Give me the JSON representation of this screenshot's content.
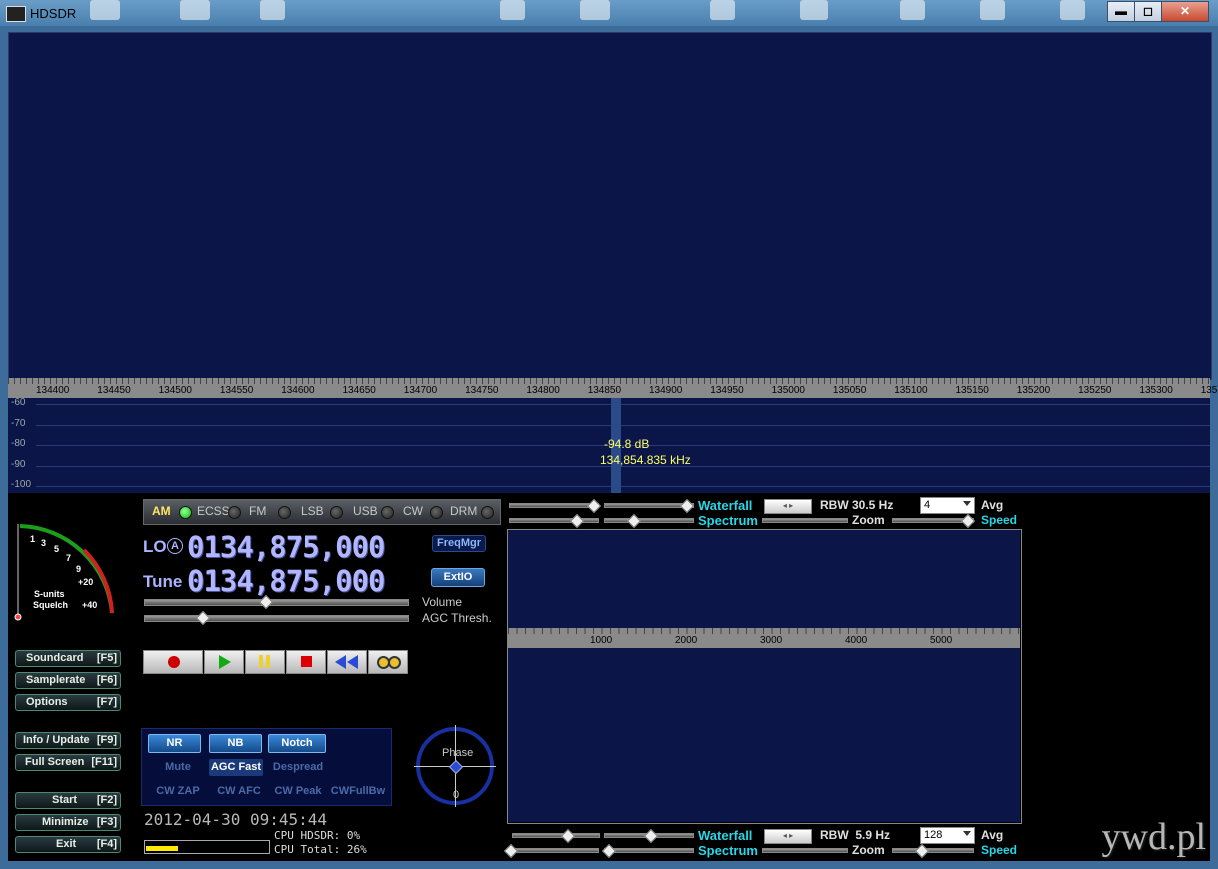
{
  "window": {
    "title": "HDSDR",
    "btn_minimize": "▬",
    "btn_maximize": "◻",
    "btn_close": "✕"
  },
  "freq_axis": [
    "134400",
    "134450",
    "134500",
    "134550",
    "134600",
    "134650",
    "134700",
    "134750",
    "134800",
    "134850",
    "134900",
    "134950",
    "135000",
    "135050",
    "135100",
    "135150",
    "135200",
    "135250",
    "135300",
    "135"
  ],
  "db_scale": [
    "-60",
    "-70",
    "-80",
    "-90",
    "-100"
  ],
  "cursor": {
    "level": "-94.8 dB",
    "freq": "134,854.835 kHz"
  },
  "smeter": {
    "ticks": [
      "1",
      "3",
      "5",
      "7",
      "9",
      "+20",
      "+40"
    ],
    "label1": "S-units",
    "label2": "Squelch"
  },
  "left_buttons": [
    {
      "label": "Soundcard",
      "key": "[F5]"
    },
    {
      "label": "Samplerate",
      "key": "[F6]"
    },
    {
      "label": "Options",
      "key": "[F7]"
    },
    {
      "label": "Info / Update",
      "key": "[F9]"
    },
    {
      "label": "Full Screen",
      "key": "[F11]"
    },
    {
      "label": "Start",
      "key": "[F2]"
    },
    {
      "label": "Minimize",
      "key": "[F3]"
    },
    {
      "label": "Exit",
      "key": "[F4]"
    }
  ],
  "modes": [
    "AM",
    "ECSS",
    "FM",
    "LSB",
    "USB",
    "CW",
    "DRM"
  ],
  "active_mode": "AM",
  "lo": {
    "label": "LO",
    "badge": "A",
    "value": "0134,875,000"
  },
  "tune": {
    "label": "Tune",
    "value": "0134,875,000"
  },
  "freqmgr": "FreqMgr",
  "extio": "ExtIO",
  "volume_label": "Volume",
  "agc_label": "AGC Thresh.",
  "volume_level": 0.46,
  "agc_level": 0.22,
  "dsp": {
    "nr": "NR",
    "nb": "NB",
    "notch": "Notch",
    "mute": "Mute",
    "agc_fast": "AGC Fast",
    "despread": "Despread",
    "cw_zap": "CW ZAP",
    "cw_afc": "CW AFC",
    "cw_peak": "CW Peak",
    "cw_fullbw": "CWFullBw"
  },
  "phase": {
    "label": "Phase",
    "value": "0"
  },
  "rf_controls": {
    "waterfall": "Waterfall",
    "spectrum": "Spectrum",
    "rbw": "RBW 30.5 Hz",
    "zoom": "Zoom",
    "avg_value": "4",
    "avg": "Avg",
    "speed": "Speed"
  },
  "af_controls": {
    "waterfall": "Waterfall",
    "spectrum": "Spectrum",
    "rbw": "RBW  5.9 Hz",
    "zoom": "Zoom",
    "avg_value": "128",
    "avg": "Avg",
    "speed": "Speed"
  },
  "audio_axis": [
    "1000",
    "2000",
    "3000",
    "4000",
    "5000"
  ],
  "datetime": "2012-04-30 09:45:44",
  "cpu_hdsdr": "CPU HDSDR: 0%",
  "cpu_total": "CPU Total: 26%",
  "cpu_bar_fraction": 0.26,
  "watermark": "ywd.pl",
  "colors": {
    "waterfall_bg": "#0c1548",
    "cursor_text": "#ffff66",
    "accent_cyan": "#29d6e8"
  }
}
